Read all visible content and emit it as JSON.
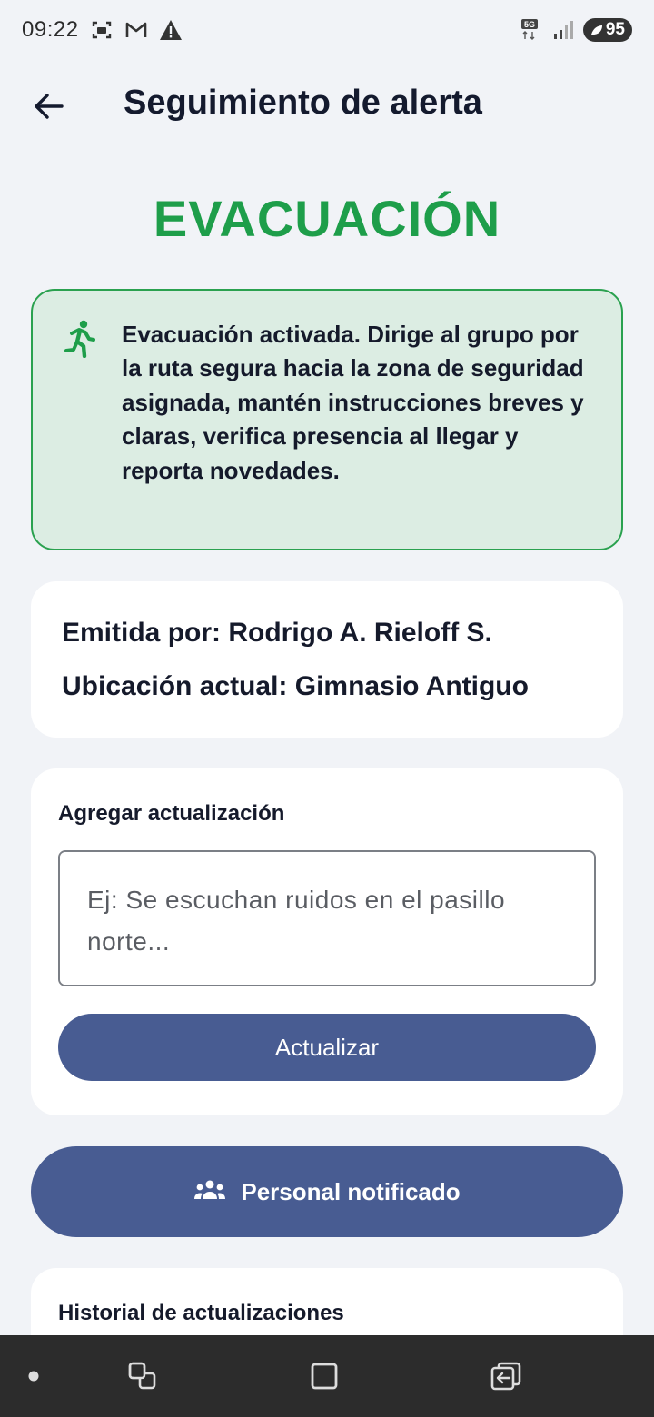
{
  "status_bar": {
    "time": "09:22",
    "battery_level": "95",
    "network": "5G",
    "left_icons": [
      "screenshot-icon",
      "gmail-icon",
      "warning-icon"
    ],
    "right_icons": [
      "5g-signal-icon",
      "cell-signal-icon",
      "battery-icon"
    ]
  },
  "header": {
    "title": "Seguimiento de alerta",
    "back_icon": "arrow-left-icon"
  },
  "alert": {
    "type": "EVACUACIÓN",
    "color": "#1e9e4a",
    "icon": "running-person-icon",
    "message": "Evacuación activada. Dirige al grupo por la ruta segura hacia la zona de seguridad asignada, mantén instrucciones breves y claras, verifica presencia al llegar y reporta novedades."
  },
  "info": {
    "issued_by": "Emitida por: Rodrigo A. Rieloff S.",
    "location": "Ubicación actual: Gimnasio Antiguo"
  },
  "update": {
    "label": "Agregar actualización",
    "placeholder": "Ej: Se escuchan ruidos en el pasillo norte...",
    "value": "",
    "button_label": "Actualizar"
  },
  "notified": {
    "label": "Personal notificado",
    "icon": "group-icon"
  },
  "history": {
    "label": "Historial de actualizaciones"
  },
  "nav_bar": {
    "items": [
      "dot-indicator-icon",
      "recent-apps-icon",
      "home-icon",
      "back-switch-icon"
    ]
  },
  "colors": {
    "accent": "#485c92",
    "success": "#1e9e4a",
    "message_bg": "#dcede3",
    "background": "#f1f3f7"
  }
}
